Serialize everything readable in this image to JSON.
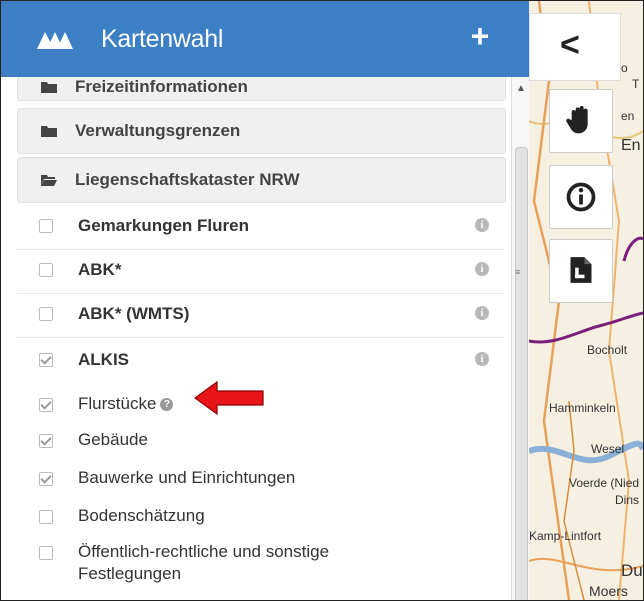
{
  "header": {
    "title": "Kartenwahl",
    "add_label": "+"
  },
  "folders": [
    {
      "label": "Freizeitinformationen"
    },
    {
      "label": "Verwaltungsgrenzen"
    },
    {
      "label": "Liegenschaftskataster NRW"
    }
  ],
  "layers": [
    {
      "label": "Gemarkungen Fluren",
      "checked": false
    },
    {
      "label": "ABK*",
      "checked": false
    },
    {
      "label": "ABK* (WMTS)",
      "checked": false
    },
    {
      "label": "ALKIS",
      "checked": true
    }
  ],
  "sublayers": [
    {
      "label": "Flurstücke",
      "checked": true
    },
    {
      "label": "Gebäude",
      "checked": true
    },
    {
      "label": "Bauwerke und Einrichtungen",
      "checked": true
    },
    {
      "label": "Bodenschätzung",
      "checked": false
    },
    {
      "label": "Öffentlich-rechtliche und sonstige",
      "label2": "Festlegungen",
      "checked": false
    }
  ],
  "info_glyph": "i",
  "help_glyph": "?",
  "map": {
    "back_label": "<",
    "places": [
      "Bocholt",
      "Hamminkeln",
      "Wesel",
      "Voerde (Nied",
      "Dins",
      "Kamp-Lintfort",
      "Dui",
      "Moers",
      "en",
      "En",
      "o",
      "T"
    ]
  },
  "colors": {
    "header": "#3d7fc4",
    "arrow": "#e8141a"
  }
}
